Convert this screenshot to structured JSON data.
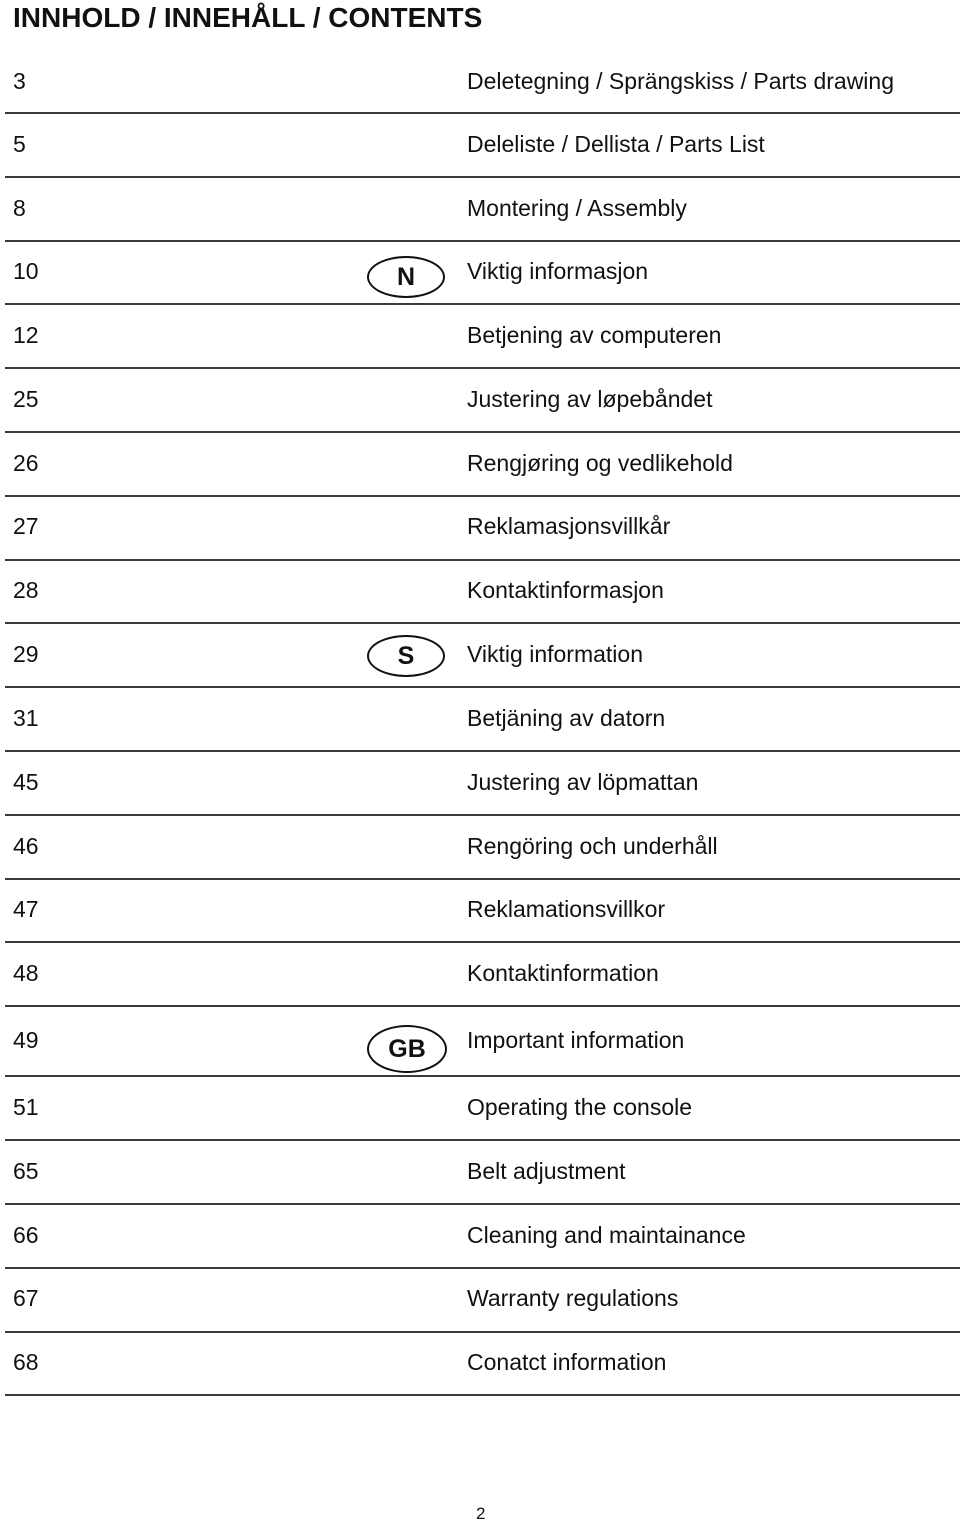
{
  "title": "INNHOLD / INNEHÅLL / CONTENTS",
  "badges": {
    "N": "N",
    "S": "S",
    "GB": "GB"
  },
  "entries": [
    {
      "page": "3",
      "text": "Deletegning / Sprängskiss / Parts drawing"
    },
    {
      "page": "5",
      "text": "Deleliste / Dellista / Parts List"
    },
    {
      "page": "8",
      "text": "Montering / Assembly"
    },
    {
      "page": "10",
      "text": "Viktig informasjon",
      "badge": "N"
    },
    {
      "page": "12",
      "text": "Betjening av computeren"
    },
    {
      "page": "25",
      "text": "Justering av løpebåndet"
    },
    {
      "page": "26",
      "text": "Rengjøring og vedlikehold"
    },
    {
      "page": "27",
      "text": "Reklamasjonsvillkår"
    },
    {
      "page": "28",
      "text": "Kontaktinformasjon"
    },
    {
      "page": "29",
      "text": "Viktig information",
      "badge": "S"
    },
    {
      "page": "31",
      "text": "Betjäning av datorn"
    },
    {
      "page": "45",
      "text": "Justering av löpmattan"
    },
    {
      "page": "46",
      "text": "Rengöring och underhåll"
    },
    {
      "page": "47",
      "text": "Reklamationsvillkor"
    },
    {
      "page": "48",
      "text": "Kontaktinformation"
    },
    {
      "page": "49",
      "text": "Important information",
      "badge": "GB"
    },
    {
      "page": "51",
      "text": "Operating the console"
    },
    {
      "page": "65",
      "text": "Belt adjustment"
    },
    {
      "page": "66",
      "text": "Cleaning and maintainance"
    },
    {
      "page": "67",
      "text": "Warranty regulations"
    },
    {
      "page": "68",
      "text": "Conatct information"
    }
  ],
  "page_number": "2"
}
